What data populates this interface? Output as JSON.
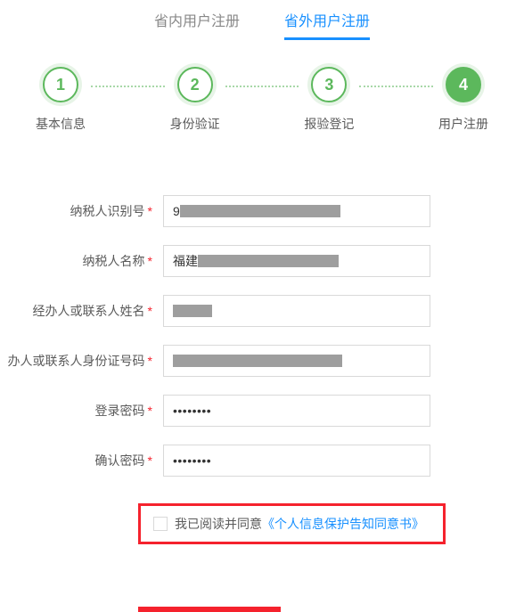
{
  "tabs": {
    "inProvince": "省内用户注册",
    "outProvince": "省外用户注册"
  },
  "steps": [
    {
      "num": "1",
      "label": "基本信息"
    },
    {
      "num": "2",
      "label": "身份验证"
    },
    {
      "num": "3",
      "label": "报验登记"
    },
    {
      "num": "4",
      "label": "用户注册"
    }
  ],
  "form": {
    "taxpayerId": {
      "label": "纳税人识别号",
      "prefix": "9"
    },
    "taxpayerName": {
      "label": "纳税人名称",
      "prefix": "福建"
    },
    "handlerName": {
      "label": "经办人或联系人姓名",
      "value": ""
    },
    "handlerIdNo": {
      "label": "办人或联系人身份证号码",
      "prefix": ""
    },
    "password": {
      "label": "登录密码",
      "masked": "••••••••"
    },
    "confirmPassword": {
      "label": "确认密码",
      "masked": "••••••••"
    }
  },
  "consent": {
    "text": "我已阅读并同意",
    "linkText": "《个人信息保护告知同意书》"
  }
}
